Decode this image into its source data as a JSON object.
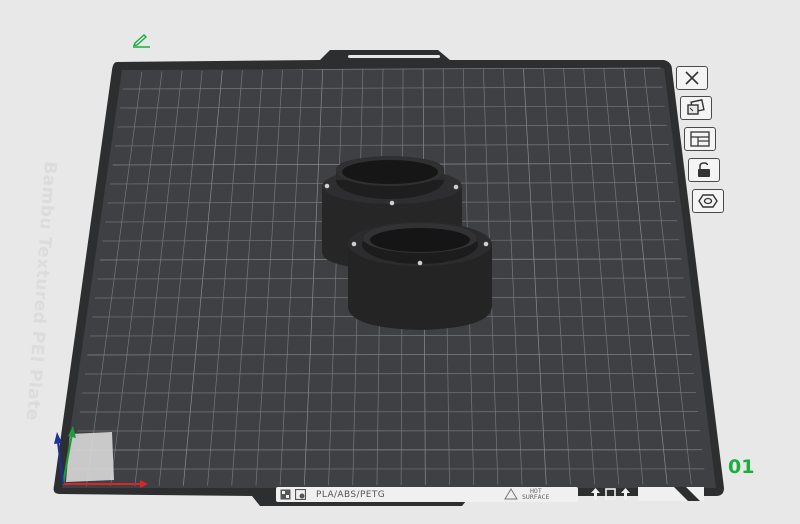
{
  "plate": {
    "name": "Bambu Textured PEI Plate",
    "number": "01"
  },
  "footer": {
    "materials": "PLA/ABS/PETG",
    "hot_line1": "HOT",
    "hot_line2": "SURFACE"
  },
  "toolbar": {
    "items": [
      {
        "icon": "close-icon"
      },
      {
        "icon": "auto-orient-icon"
      },
      {
        "icon": "arrange-icon"
      },
      {
        "icon": "lock-icon"
      },
      {
        "icon": "plate-settings-icon"
      }
    ]
  },
  "colors": {
    "plate": "#3c3d3f",
    "plate_border": "#2c2c2e",
    "grid": "#6e6f72",
    "model": "#232323",
    "accent_green": "#1aae3f"
  }
}
